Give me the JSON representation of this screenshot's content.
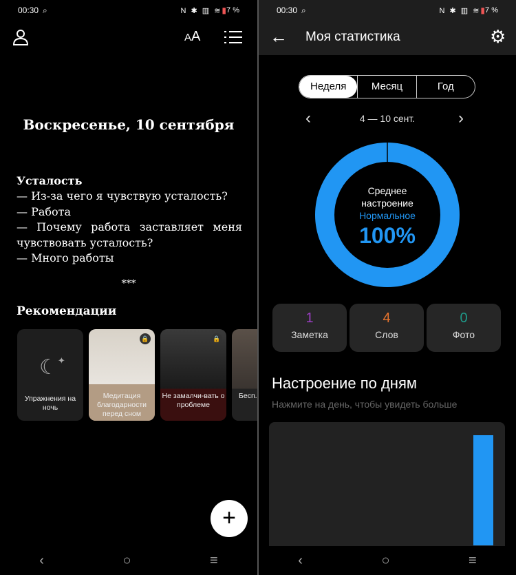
{
  "status_bar": {
    "time": "00:30",
    "icons": "N ✱ ▥ ≋",
    "battery": "7 %"
  },
  "left": {
    "date_title": "Воскресенье, 10 сентября",
    "entry_lines": [
      "Усталость",
      "— Из-за чего я чувствую усталость?",
      "— Работа",
      "— Почему работа заставляет меня чувствовать усталость?",
      "— Много работы"
    ],
    "separator": "***",
    "recommendations_title": "Рекомендации",
    "cards": [
      {
        "label": "Упражнения на ночь"
      },
      {
        "label": "Медитация благодарности перед сном",
        "locked": true
      },
      {
        "label": "Не замалчи-вать о проблеме",
        "locked": true
      },
      {
        "label": "Бесп... бесс..."
      }
    ],
    "fab": "+"
  },
  "right": {
    "title": "Моя статистика",
    "tabs": [
      "Неделя",
      "Месяц",
      "Год"
    ],
    "selected_tab": "Неделя",
    "range": "4 — 10 сент.",
    "donut": {
      "line1": "Среднее",
      "line2": "настроение",
      "mood": "Нормальное",
      "percent": "100%",
      "color": "#2196f3"
    },
    "stats": [
      {
        "value": "1",
        "label": "Заметка",
        "color": "#9c3fc4"
      },
      {
        "value": "4",
        "label": "Слов",
        "color": "#e8742e"
      },
      {
        "value": "0",
        "label": "Фото",
        "color": "#1f9a8a"
      }
    ],
    "mood_title": "Настроение по дням",
    "mood_hint": "Нажмите на день, чтобы увидеть больше"
  },
  "nav": {
    "back": "‹",
    "home": "○",
    "menu": "≡"
  }
}
